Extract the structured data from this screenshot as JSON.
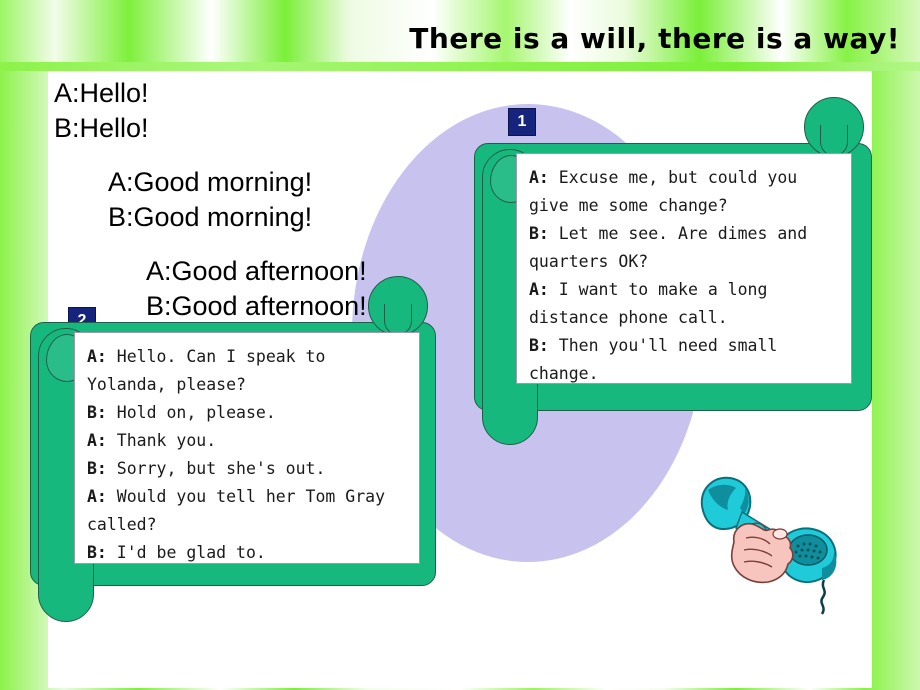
{
  "slide": {
    "title": "There is a will, there is a way!",
    "accent_green": "#17b87e",
    "accent_purple": "#c8c2ef",
    "badge_blue": "#16247e",
    "header_green": "#7bef38"
  },
  "greetings": {
    "groups": [
      {
        "lines": [
          "A:Hello!",
          "B:Hello!"
        ]
      },
      {
        "lines": [
          "A:Good morning!",
          "B:Good morning!"
        ]
      },
      {
        "lines": [
          "A:Good afternoon!",
          "B:Good afternoon!"
        ]
      }
    ]
  },
  "dialogues": [
    {
      "number": "1",
      "icon": "scroll-icon",
      "text": "A: Excuse me, but could you give me some change?\nB: Let me see. Are dimes and quarters OK?\nA: I want to make a long distance phone call.\nB: Then you'll need small change."
    },
    {
      "number": "2",
      "icon": "scroll-icon",
      "text": "A: Hello. Can I speak to Yolanda, please?\nB: Hold on, please.\nA: Thank you.\nB: Sorry, but she's out.\nA: Would you tell her Tom Gray called?\nB: I'd be glad to."
    }
  ],
  "illustration": {
    "name": "hand-holding-telephone-handset",
    "handset_color": "#1fcbd8",
    "handset_dark": "#0f8f9e",
    "hand_color": "#f7c4be"
  }
}
